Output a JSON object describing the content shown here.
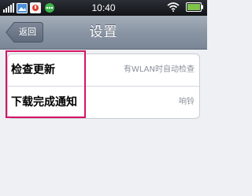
{
  "status_bar": {
    "time": "10:40",
    "icons": [
      "signal-icon",
      "gallery-icon",
      "notification-icon",
      "chat-icon",
      "wifi-icon",
      "battery-icon"
    ]
  },
  "nav_bar": {
    "back_label": "返回",
    "title": "设置"
  },
  "settings": {
    "rows": [
      {
        "label": "检查更新",
        "value": "有WLAN时自动检查"
      },
      {
        "label": "下载完成通知",
        "value": "响铃"
      }
    ]
  },
  "colors": {
    "highlight": "#d31567",
    "navbar": "#8a95a4",
    "background": "#eef0f4"
  }
}
